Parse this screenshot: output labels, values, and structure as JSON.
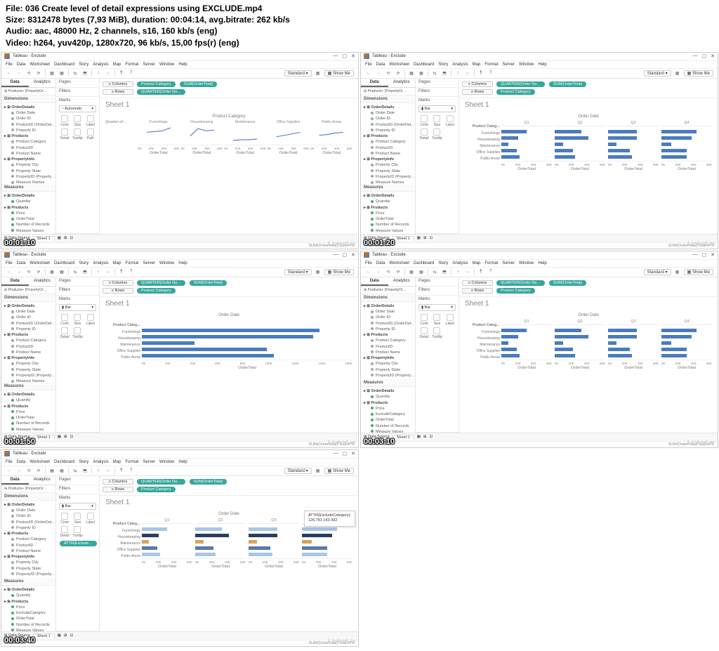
{
  "meta": {
    "file_label": "File:",
    "file_value": "036 Create level of detail expressions using EXCLUDE.mp4",
    "size_label": "Size:",
    "size_value": "8312478 bytes (7,93 MiB), duration: 00:04:14, avg.bitrate: 262 kb/s",
    "audio_label": "Audio:",
    "audio_value": "aac, 48000 Hz, 2 channels, s16, 160 kb/s (eng)",
    "video_label": "Video:",
    "video_value": "h264, yuv420p, 1280x720, 96 kb/s, 15,00 fps(r) (eng)"
  },
  "common": {
    "app_title": "Tableau - Exclude",
    "menus": [
      "File",
      "Data",
      "Worksheet",
      "Dashboard",
      "Story",
      "Analysis",
      "Map",
      "Format",
      "Server",
      "Window",
      "Help"
    ],
    "show_me": "Show Me",
    "standard": "Standard",
    "data_tab": "Data",
    "analytics_tab": "Analytics",
    "pages_h": "Pages",
    "filters_h": "Filters",
    "marks_h": "Marks",
    "columns": "Columns",
    "rows": "Rows",
    "sheet_title": "Sheet 1",
    "data_source": "Products+ (PropertyOr…",
    "dimensions_h": "Dimensions",
    "measures_h": "Measures",
    "dim_order": "OrderDetails",
    "dim_items_order": [
      "Order Date",
      "Order ID",
      "ProductID (OrderDet…",
      "Property ID"
    ],
    "dim_products": "Products",
    "dim_items_products": [
      "Product Category",
      "ProductID",
      "Product Name"
    ],
    "dim_property": "PropertyInfo",
    "dim_items_property": [
      "Property City",
      "Property State",
      "PropertyID (Property…"
    ],
    "dim_measure_names": "Measure Names",
    "meas_order": "OrderDetails",
    "meas_items_order": [
      "Quantity"
    ],
    "meas_products": "Products",
    "meas_items_products": [
      "Price",
      "OrderTotal",
      "Number of Records",
      "Measure Values"
    ],
    "meas_items_products_ex": [
      "Price",
      "ExcludeCategory",
      "OrderTotal",
      "Number of Records",
      "Measure Values"
    ],
    "mark_auto": "Automatic",
    "mark_bar": "Bar",
    "mark_btns": [
      "Color",
      "Size",
      "Label",
      "Detail",
      "Tooltip",
      "Path"
    ],
    "mark_btns_short": [
      "Color",
      "Size",
      "Label",
      "Detail",
      "Tooltip"
    ],
    "sheet_tab": "Sheet 1",
    "data_source_tab": "Data Source",
    "status": "SUM(OrderTotal): 533,479",
    "watermark": "Linked in",
    "order_date_header": "Order Date",
    "order_total_axis": "OrderTotal",
    "product_category_label": "Product Categ…",
    "product_category_full": "Product Category",
    "quarters": [
      "Q1",
      "Q2",
      "Q3",
      "Q4"
    ],
    "ticks_20_60": [
      "0K",
      "20K",
      "40K",
      "60K"
    ],
    "categories": [
      "Furnishings",
      "Housekeeping",
      "Maintenance",
      "Office Supplies",
      "Public Areas"
    ]
  },
  "thumbs": {
    "t1": {
      "timestamp": "00:01:10",
      "cols_pills": [
        "Product Category",
        "SUM(OrderTotal)"
      ],
      "rows_pills": [
        "QUARTER(Order Da…"
      ],
      "quarter_of": "Quarter of…",
      "ticks": [
        "0K",
        "20K",
        "40K",
        "60K"
      ]
    },
    "t2": {
      "timestamp": "00:01:20",
      "cols_pills": [
        "QUARTER(Order Da…",
        "SUM(OrderTotal)"
      ],
      "rows_pills": [
        "Product Category"
      ]
    },
    "t3": {
      "timestamp": "00:01:50",
      "cols_pills": [
        "QUARTER(Order Da…",
        "SUM(OrderTotal)"
      ],
      "rows_pills": [
        "Product Category"
      ],
      "single_axis_ticks": [
        "0K",
        "20K",
        "40K",
        "60K",
        "80K",
        "100K",
        "120K",
        "140K",
        "160K"
      ]
    },
    "t4": {
      "timestamp": "00:03:10",
      "cols_pills": [
        "QUARTER(Order Da…",
        "SUM(OrderTotal)"
      ],
      "rows_pills": [
        "Product Category"
      ]
    },
    "t5": {
      "timestamp": "00:03:40",
      "cols_pills": [
        "QUARTER(Order Da…",
        "SUM(OrderTotal)"
      ],
      "rows_pills": [
        "Product Category"
      ],
      "attr_pill": "ATTR(Exclude…",
      "tooltip_label": "ATTR(ExcludeCategory):",
      "tooltip_vals": "126,781   142,092"
    }
  },
  "chart_data": [
    {
      "type": "bar",
      "thumb": 2,
      "title": "Order Date",
      "ylabel": "Product Category",
      "xlabel": "OrderTotal",
      "facets": [
        "Q1",
        "Q2",
        "Q3",
        "Q4"
      ],
      "categories": [
        "Furnishings",
        "Housekeeping",
        "Maintenance",
        "Office Supplies",
        "Public Areas"
      ],
      "series": {
        "Q1": [
          30,
          20,
          8,
          18,
          22
        ],
        "Q2": [
          32,
          40,
          10,
          22,
          24
        ],
        "Q3": [
          34,
          34,
          10,
          26,
          28
        ],
        "Q4": [
          42,
          36,
          12,
          30,
          30
        ]
      },
      "xlim": [
        0,
        60
      ]
    },
    {
      "type": "bar",
      "thumb": 3,
      "title": "Order Date (single axis)",
      "ylabel": "Product Category",
      "xlabel": "OrderTotal",
      "categories": [
        "Furnishings",
        "Housekeeping",
        "Maintenance",
        "Office Supplies",
        "Public Areas"
      ],
      "values": [
        135,
        130,
        40,
        95,
        100
      ],
      "xlim": [
        0,
        160
      ]
    },
    {
      "type": "bar",
      "thumb": 4,
      "title": "Order Date",
      "facets": [
        "Q1",
        "Q2",
        "Q3",
        "Q4"
      ],
      "categories": [
        "Furnishings",
        "Housekeeping",
        "Maintenance",
        "Office Supplies",
        "Public Areas"
      ],
      "series": {
        "Q1": [
          30,
          20,
          8,
          18,
          22
        ],
        "Q2": [
          32,
          40,
          10,
          22,
          24
        ],
        "Q3": [
          34,
          34,
          10,
          26,
          28
        ],
        "Q4": [
          42,
          36,
          12,
          30,
          30
        ]
      },
      "xlim": [
        0,
        60
      ]
    },
    {
      "type": "bar",
      "thumb": 5,
      "title": "Order Date (with ATTR Exclude color)",
      "facets": [
        "Q1",
        "Q2",
        "Q3",
        "Q4"
      ],
      "categories": [
        "Furnishings",
        "Housekeeping",
        "Maintenance",
        "Office Supplies",
        "Public Areas"
      ],
      "series": {
        "Q1": [
          30,
          20,
          8,
          18,
          22
        ],
        "Q2": [
          32,
          40,
          10,
          22,
          24
        ],
        "Q3": [
          34,
          34,
          10,
          26,
          28
        ],
        "Q4": [
          42,
          36,
          12,
          30,
          30
        ]
      },
      "xlim": [
        0,
        60
      ]
    },
    {
      "type": "line",
      "thumb": 1,
      "title": "OrderTotal by Quarter × Product Category (sparklines)",
      "facets": [
        "Furnishings",
        "Housekeeping",
        "Maintenance",
        "Office Supplies",
        "Public Areas"
      ],
      "x": [
        "Q1",
        "Q2",
        "Q3",
        "Q4"
      ],
      "series": {
        "Furnishings": [
          30,
          32,
          34,
          42
        ],
        "Housekeeping": [
          20,
          40,
          34,
          36
        ],
        "Maintenance": [
          8,
          10,
          10,
          12
        ],
        "Office Supplies": [
          18,
          22,
          26,
          30
        ],
        "Public Areas": [
          22,
          24,
          28,
          30
        ]
      }
    }
  ]
}
